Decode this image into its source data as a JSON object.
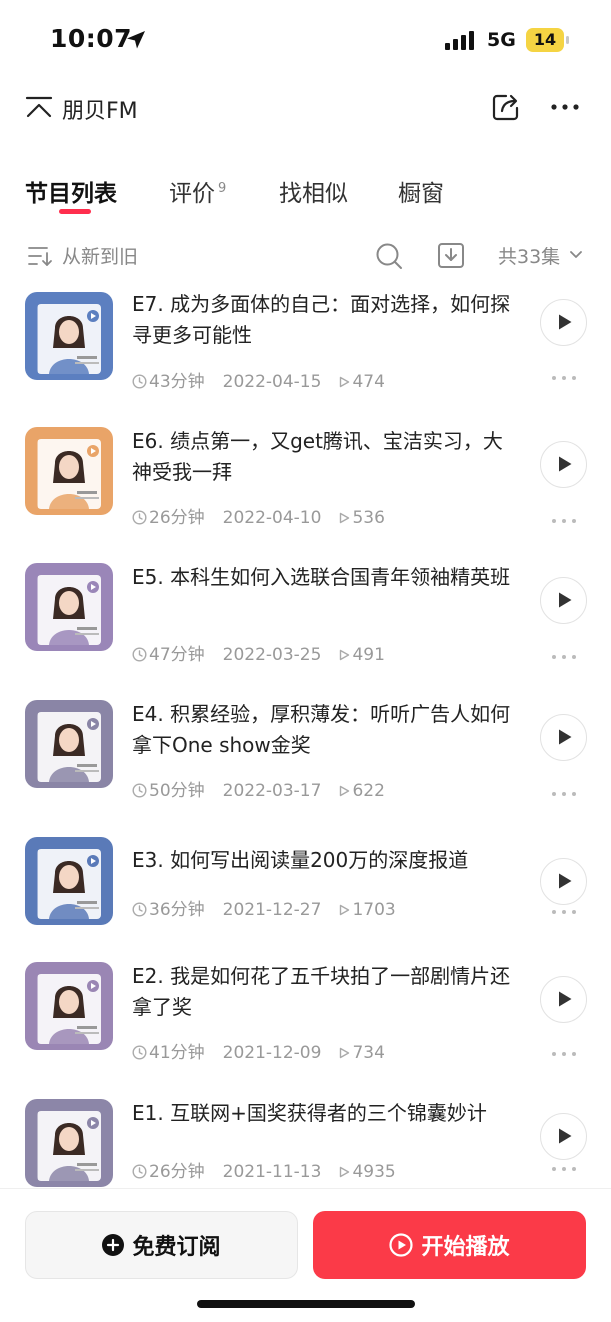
{
  "status_bar": {
    "time": "10:07",
    "network": "5G",
    "battery": "14",
    "location_icon": "location-arrow-icon",
    "signal_icon": "signal-bars-icon"
  },
  "header": {
    "podcast_name": "朋贝FM",
    "collapse_icon": "chevron-up-icon",
    "share_icon": "share-icon",
    "more_icon": "more-icon"
  },
  "tabs": [
    {
      "label": "节目列表",
      "active": true
    },
    {
      "label": "评价",
      "badge": "9"
    },
    {
      "label": "找相似"
    },
    {
      "label": "橱窗"
    }
  ],
  "sort": {
    "label": "从新到旧",
    "count": "共33集"
  },
  "episodes": [
    {
      "title": "E7. 成为多面体的自己：面对选择，如何探寻更多可能性",
      "duration": "43分钟",
      "date": "2022-04-15",
      "plays": "474",
      "cover_bg": "#5c7fc0"
    },
    {
      "title": "E6. 绩点第一，又get腾讯、宝洁实习，大神受我一拜",
      "duration": "26分钟",
      "date": "2022-04-10",
      "plays": "536",
      "cover_bg": "#e9a468"
    },
    {
      "title": "E5. 本科生如何入选联合国青年领袖精英班",
      "duration": "47分钟",
      "date": "2022-03-25",
      "plays": "491",
      "cover_bg": "#9a86b8"
    },
    {
      "title": "E4. 积累经验，厚积薄发：听听广告人如何拿下One show金奖",
      "duration": "50分钟",
      "date": "2022-03-17",
      "plays": "622",
      "cover_bg": "#8a85a6"
    },
    {
      "title": "E3. 如何写出阅读量200万的深度报道",
      "duration": "36分钟",
      "date": "2021-12-27",
      "plays": "1703",
      "cover_bg": "#5a7ab8"
    },
    {
      "title": "E2. 我是如何花了五千块拍了一部剧情片还拿了奖",
      "duration": "41分钟",
      "date": "2021-12-09",
      "plays": "734",
      "cover_bg": "#9a86b4"
    },
    {
      "title": "E1. 互联网+国奖获得者的三个锦囊妙计",
      "duration": "26分钟",
      "date": "2021-11-13",
      "plays": "4935",
      "cover_bg": "#8c86a8"
    }
  ],
  "bottom": {
    "subscribe_label": "免费订阅",
    "play_all_label": "开始播放",
    "accent_color": "#fb3a48"
  }
}
